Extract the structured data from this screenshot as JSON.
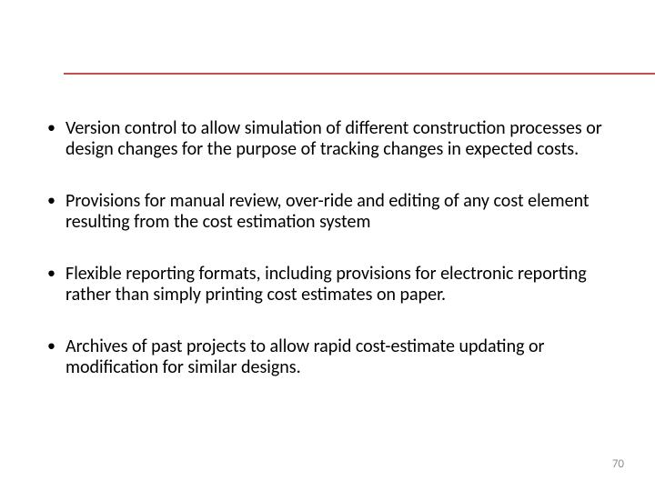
{
  "accent_color": "#c0504d",
  "bullets": [
    "Version control to allow simulation of different construction processes or design changes for the purpose of tracking changes in expected costs.",
    "Provisions for manual review, over-ride and editing of any cost element resulting from the cost estimation system",
    "Flexible reporting formats, including provisions for electronic reporting rather than simply printing cost estimates on paper.",
    "Archives of past projects to allow rapid cost-estimate updating or modification for similar designs."
  ],
  "page_number": "70"
}
